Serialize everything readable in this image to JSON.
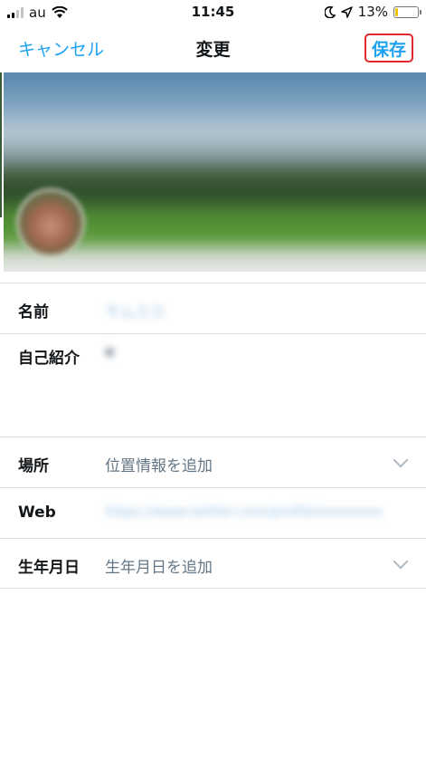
{
  "status_bar": {
    "carrier": "au",
    "time": "11:45",
    "battery_percent": "13%",
    "battery_level": 0.13,
    "icons": [
      "signal-icon",
      "wifi-icon",
      "moon-icon",
      "location-arrow-icon",
      "battery-icon"
    ]
  },
  "nav": {
    "cancel_label": "キャンセル",
    "title": "変更",
    "save_label": "保存"
  },
  "form": {
    "name_label": "名前",
    "name_value": "サムエエ",
    "bio_label": "自己紹介",
    "bio_value": "●",
    "location_label": "場所",
    "location_placeholder": "位置情報を追加",
    "web_label": "Web",
    "web_value": "https://www.twitter.com/profile/xxxxxxxx",
    "birthday_label": "生年月日",
    "birthday_placeholder": "生年月日を追加"
  },
  "colors": {
    "accent": "#1da1f2",
    "highlight_border": "#e0282e",
    "divider": "#dcdfe3"
  }
}
